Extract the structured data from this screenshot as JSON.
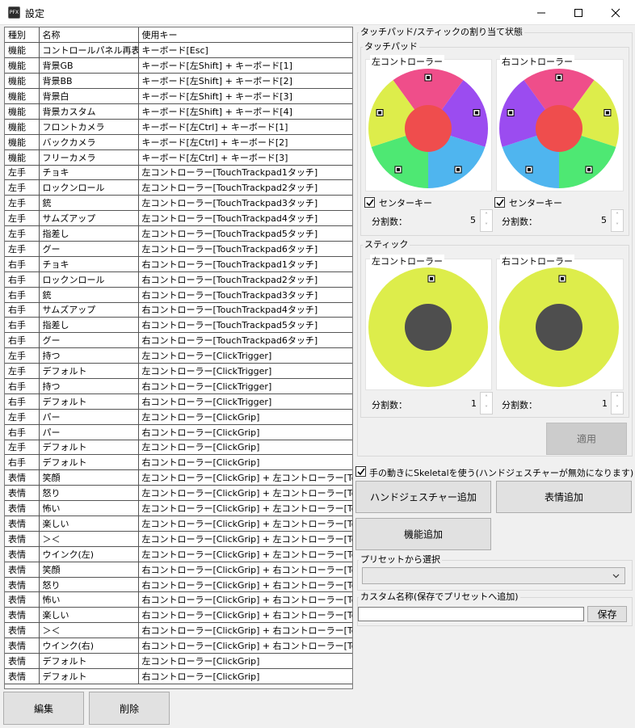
{
  "window": {
    "title": "設定",
    "icon_text": "PFX"
  },
  "table": {
    "headers": [
      "種別",
      "名称",
      "使用キー"
    ],
    "rows": [
      [
        "機能",
        "コントロールパネル再表示",
        "キーボード[Esc]"
      ],
      [
        "機能",
        "背景GB",
        "キーボード[左Shift] + キーボード[1]"
      ],
      [
        "機能",
        "背景BB",
        "キーボード[左Shift] + キーボード[2]"
      ],
      [
        "機能",
        "背景白",
        "キーボード[左Shift] + キーボード[3]"
      ],
      [
        "機能",
        "背景カスタム",
        "キーボード[左Shift] + キーボード[4]"
      ],
      [
        "機能",
        "フロントカメラ",
        "キーボード[左Ctrl] + キーボード[1]"
      ],
      [
        "機能",
        "バックカメラ",
        "キーボード[左Ctrl] + キーボード[2]"
      ],
      [
        "機能",
        "フリーカメラ",
        "キーボード[左Ctrl] + キーボード[3]"
      ],
      [
        "左手",
        "チョキ",
        "左コントローラー[TouchTrackpad1タッチ]"
      ],
      [
        "左手",
        "ロックンロール",
        "左コントローラー[TouchTrackpad2タッチ]"
      ],
      [
        "左手",
        "銃",
        "左コントローラー[TouchTrackpad3タッチ]"
      ],
      [
        "左手",
        "サムズアップ",
        "左コントローラー[TouchTrackpad4タッチ]"
      ],
      [
        "左手",
        "指差し",
        "左コントローラー[TouchTrackpad5タッチ]"
      ],
      [
        "左手",
        "グー",
        "左コントローラー[TouchTrackpad6タッチ]"
      ],
      [
        "右手",
        "チョキ",
        "右コントローラー[TouchTrackpad1タッチ]"
      ],
      [
        "右手",
        "ロックンロール",
        "右コントローラー[TouchTrackpad2タッチ]"
      ],
      [
        "右手",
        "銃",
        "右コントローラー[TouchTrackpad3タッチ]"
      ],
      [
        "右手",
        "サムズアップ",
        "右コントローラー[TouchTrackpad4タッチ]"
      ],
      [
        "右手",
        "指差し",
        "右コントローラー[TouchTrackpad5タッチ]"
      ],
      [
        "右手",
        "グー",
        "右コントローラー[TouchTrackpad6タッチ]"
      ],
      [
        "左手",
        "持つ",
        "左コントローラー[ClickTrigger]"
      ],
      [
        "左手",
        "デフォルト",
        "左コントローラー[ClickTrigger]"
      ],
      [
        "右手",
        "持つ",
        "右コントローラー[ClickTrigger]"
      ],
      [
        "右手",
        "デフォルト",
        "右コントローラー[ClickTrigger]"
      ],
      [
        "左手",
        "パー",
        "左コントローラー[ClickGrip]"
      ],
      [
        "右手",
        "パー",
        "右コントローラー[ClickGrip]"
      ],
      [
        "左手",
        "デフォルト",
        "左コントローラー[ClickGrip]"
      ],
      [
        "右手",
        "デフォルト",
        "右コントローラー[ClickGrip]"
      ],
      [
        "表情",
        "笑顔",
        "左コントローラー[ClickGrip] + 左コントローラー[TouchTra"
      ],
      [
        "表情",
        "怒り",
        "左コントローラー[ClickGrip] + 左コントローラー[TouchTra"
      ],
      [
        "表情",
        "怖い",
        "左コントローラー[ClickGrip] + 左コントローラー[TouchTra"
      ],
      [
        "表情",
        "楽しい",
        "左コントローラー[ClickGrip] + 左コントローラー[TouchTra"
      ],
      [
        "表情",
        "＞＜",
        "左コントローラー[ClickGrip] + 左コントローラー[TouchTra"
      ],
      [
        "表情",
        "ウインク(左)",
        "左コントローラー[ClickGrip] + 左コントローラー[TouchTra"
      ],
      [
        "表情",
        "笑顔",
        "右コントローラー[ClickGrip] + 右コントローラー[TouchTra"
      ],
      [
        "表情",
        "怒り",
        "右コントローラー[ClickGrip] + 右コントローラー[TouchTra"
      ],
      [
        "表情",
        "怖い",
        "右コントローラー[ClickGrip] + 右コントローラー[TouchTra"
      ],
      [
        "表情",
        "楽しい",
        "右コントローラー[ClickGrip] + 右コントローラー[TouchTra"
      ],
      [
        "表情",
        "＞＜",
        "右コントローラー[ClickGrip] + 右コントローラー[TouchTra"
      ],
      [
        "表情",
        "ウインク(右)",
        "右コントローラー[ClickGrip] + 右コントローラー[TouchTra"
      ],
      [
        "表情",
        "デフォルト",
        "左コントローラー[ClickGrip]"
      ],
      [
        "表情",
        "デフォルト",
        "右コントローラー[ClickGrip]"
      ]
    ]
  },
  "bottom_buttons": {
    "edit": "編集",
    "delete": "削除"
  },
  "assign": {
    "group_title": "タッチパッド/スティックの割り当て状態",
    "touchpad": {
      "title": "タッチパッド",
      "left_title": "左コントローラー",
      "right_title": "右コントローラー",
      "center_key_label": "センターキー",
      "left_center_key": true,
      "right_center_key": true,
      "divisions_label": "分割数：",
      "left_divisions": "5",
      "right_divisions": "5",
      "left_colors": [
        "#ef4e8a",
        "#9b4cf0",
        "#4fb5ef",
        "#4ee873",
        "#dded4b"
      ],
      "right_colors": [
        "#ef4e8a",
        "#dded4b",
        "#4ee873",
        "#4fb5ef",
        "#9b4cf0"
      ],
      "center_color": "#ef4d4d"
    },
    "stick": {
      "title": "スティック",
      "left_title": "左コントローラー",
      "right_title": "右コントローラー",
      "divisions_label": "分割数：",
      "left_divisions": "1",
      "right_divisions": "1",
      "ring_color": "#dded4b",
      "center_color": "#4e4e4e"
    },
    "apply_button": "適用"
  },
  "skeletal": {
    "checked": true,
    "label": "手の動きにSkeletalを使う(ハンドジェスチャーが無効になります)"
  },
  "actions": {
    "add_hand_gesture": "ハンドジェスチャー追加",
    "add_expression": "表情追加",
    "add_function": "機能追加"
  },
  "preset": {
    "group_title": "プリセットから選択",
    "selected": ""
  },
  "custom_name": {
    "group_title": "カスタム名称(保存でプリセットへ追加)",
    "value": "",
    "save_button": "保存"
  }
}
